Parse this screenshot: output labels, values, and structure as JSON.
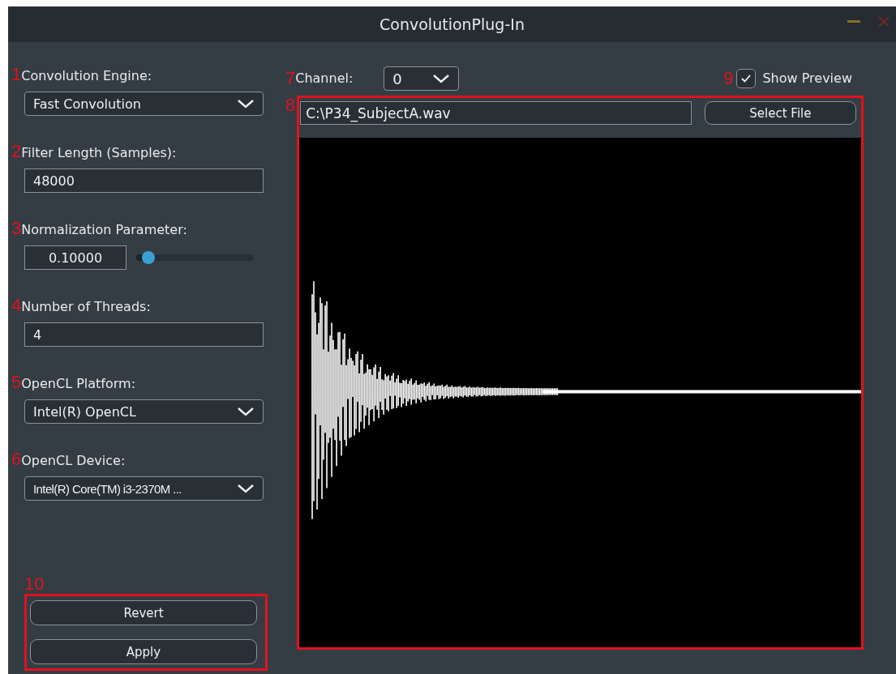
{
  "window": {
    "title": "ConvolutionPlug-In"
  },
  "settings": [
    {
      "marker": "1",
      "label": "Convolution Engine:",
      "kind": "dropdown",
      "value": "Fast Convolution"
    },
    {
      "marker": "2",
      "label": "Filter Length (Samples):",
      "kind": "text",
      "value": "48000"
    },
    {
      "marker": "3",
      "label": "Normalization Parameter:",
      "kind": "slider",
      "value": "0.10000",
      "level": 0.1
    },
    {
      "marker": "4",
      "label": "Number of Threads:",
      "kind": "text",
      "value": "4"
    },
    {
      "marker": "5",
      "label": "OpenCL Platform:",
      "kind": "dropdown",
      "value": "Intel(R) OpenCL"
    },
    {
      "marker": "6",
      "label": "OpenCL Device:",
      "kind": "dropdown",
      "value": "Intel(R) Core(TM) i3-2370M ...",
      "condensed": true
    }
  ],
  "actions": {
    "marker": "10",
    "buttons": [
      "Revert",
      "Apply"
    ]
  },
  "channel": {
    "marker": "7",
    "label": "Channel:",
    "value": "0"
  },
  "preview": {
    "marker": "9",
    "label": "Show Preview",
    "checked": true
  },
  "file": {
    "marker": "8",
    "path": "C:\\P34_SubjectA.wav",
    "button": "Select File"
  }
}
